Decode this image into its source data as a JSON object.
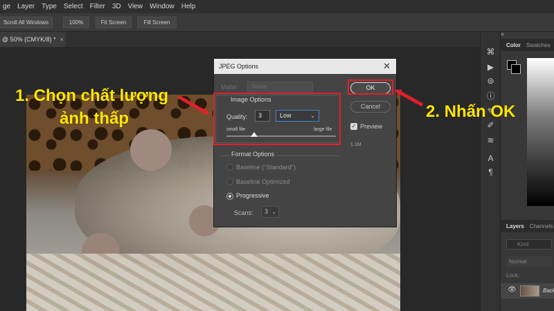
{
  "menu": [
    "ge",
    "Layer",
    "Type",
    "Select",
    "Filter",
    "3D",
    "View",
    "Window",
    "Help"
  ],
  "options_bar": {
    "scroll_all": "Scroll All Windows",
    "zoom": "100%",
    "fit_screen": "Fit Screen",
    "fill_screen": "Fill Screen"
  },
  "doc_tab": {
    "label": "@ 50% (CMYK/8) *",
    "close": "×"
  },
  "panels": {
    "color_tab": "Color",
    "swatches_tab": "Swatches",
    "layers_tab": "Layers",
    "channels_tab": "Channels",
    "kind_placeholder": "Kind",
    "blend_mode": "Normal",
    "lock_label": "Lock:",
    "layer_name": "Backg",
    "collapse": "«"
  },
  "dialog": {
    "title": "JPEG Options",
    "close": "✕",
    "matte_label": "Matte:",
    "matte_value": "None",
    "image_options_label": "Image Options",
    "quality_label": "Quality:",
    "quality_value": "3",
    "quality_level": "Low",
    "small_file": "small file",
    "large_file": "large file",
    "slider_value": 3,
    "slider_max": 12,
    "format_options_label": "Format Options",
    "format_baseline_standard": "Baseline (\"Standard\")",
    "format_baseline_optimized": "Baseline Optimized",
    "format_progressive": "Progressive",
    "scans_label": "Scans:",
    "scans_value": "3",
    "ok": "OK",
    "cancel": "Cancel",
    "preview_label": "Preview",
    "file_size": "1.1M"
  },
  "annotations": {
    "step1_line1": "1. Chọn chất lượng",
    "step1_line2": "ảnh thấp",
    "step2": "2. Nhấn OK",
    "text_color": "#ffe600",
    "highlight_color": "#e0202a"
  }
}
